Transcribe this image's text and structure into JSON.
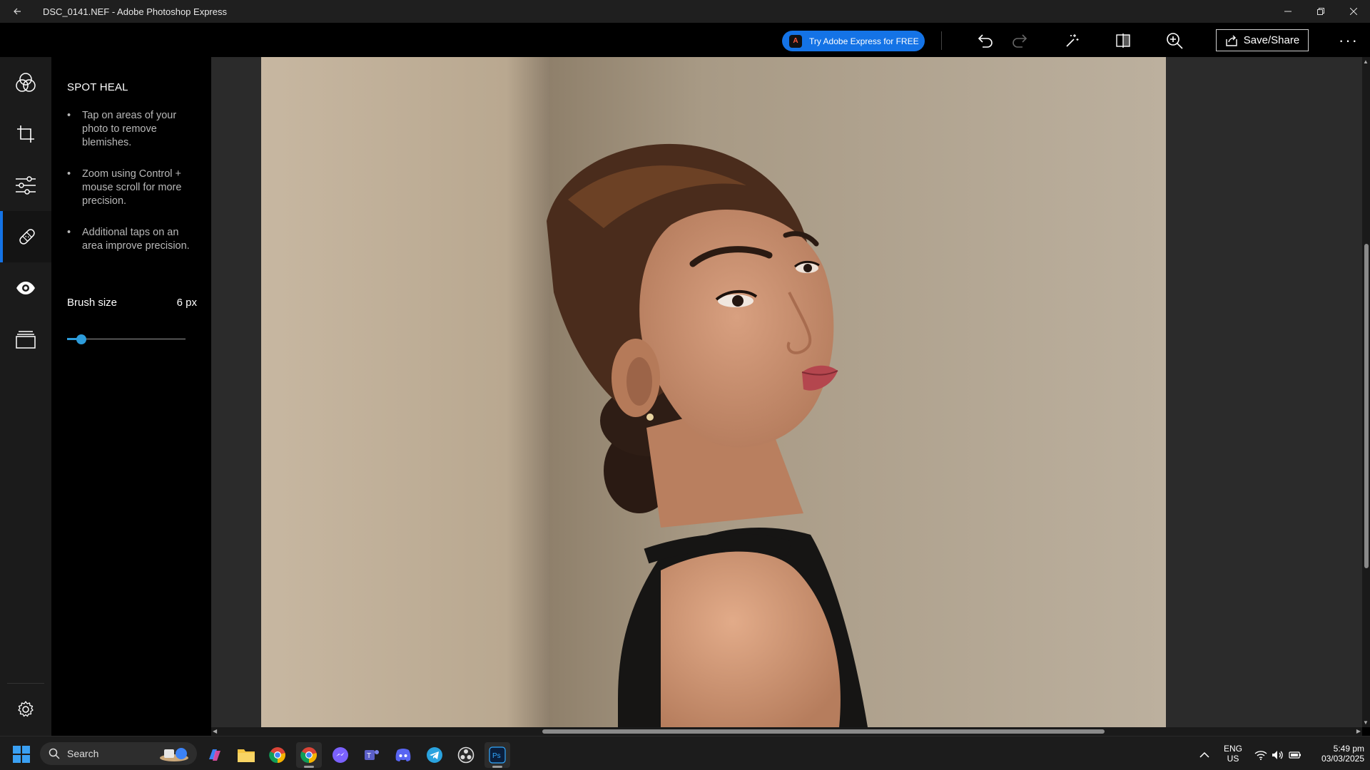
{
  "window": {
    "title": "DSC_0141.NEF - Adobe Photoshop Express",
    "back_icon": "arrow-left-icon"
  },
  "toolbar": {
    "try_label": "Try Adobe Express for FREE",
    "save_label": "Save/Share",
    "more_label": "···"
  },
  "rail": {
    "items": [
      "looks-icon",
      "crop-icon",
      "adjustments-icon",
      "spot-heal-icon",
      "red-eye-icon",
      "layers-icon"
    ],
    "settings": "gear-icon",
    "active_index": 3
  },
  "panel": {
    "title": "SPOT HEAL",
    "tips": [
      "Tap on areas of your photo to remove blemishes.",
      "Zoom using Control + mouse scroll for more precision.",
      "Additional taps on an area improve precision."
    ],
    "brush_label": "Brush size",
    "brush_value": "6 px",
    "brush_level": 0.09
  },
  "taskbar": {
    "search_label": "Search",
    "lang_line1": "ENG",
    "lang_line2": "US",
    "time": "5:49 pm",
    "date": "03/03/2025"
  },
  "colors": {
    "accent": "#1473e6",
    "slider": "#2d9cdb"
  }
}
